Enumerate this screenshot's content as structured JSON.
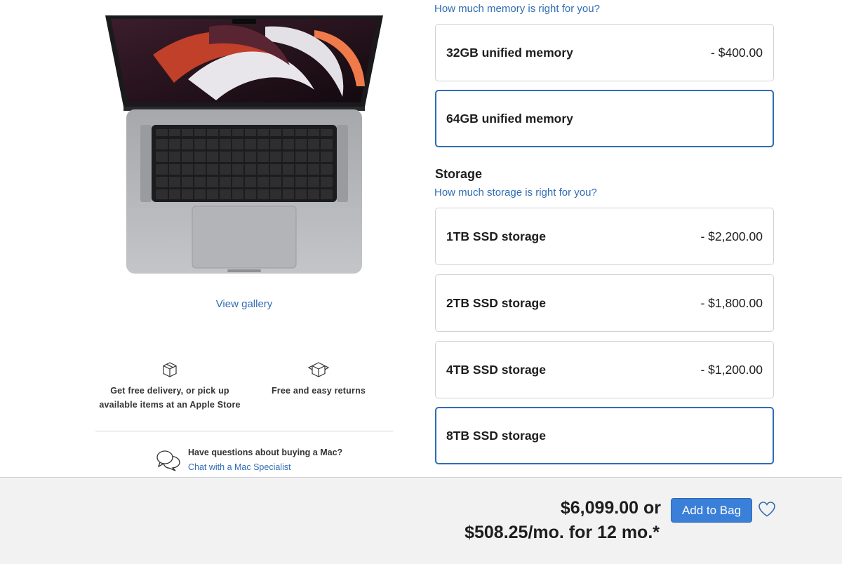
{
  "gallery": {
    "view_label": "View gallery"
  },
  "perks": {
    "delivery_line1": "Get free delivery, or pick up",
    "delivery_line2": "available items at an Apple Store",
    "delivery_icon": "box-icon",
    "returns_label": "Free and easy returns",
    "returns_icon": "return-box-icon"
  },
  "chat": {
    "question": "Have questions about buying a Mac?",
    "link": "Chat with a Mac Specialist",
    "icon": "chat-bubbles-icon"
  },
  "memory": {
    "help_link": "How much memory is right for you?",
    "options": [
      {
        "label": "32GB unified memory",
        "price": "- $400.00",
        "selected": false
      },
      {
        "label": "64GB unified memory",
        "price": "",
        "selected": true
      }
    ]
  },
  "storage": {
    "heading": "Storage",
    "help_link": "How much storage is right for you?",
    "options": [
      {
        "label": "1TB SSD storage",
        "price": "- $2,200.00",
        "selected": false
      },
      {
        "label": "2TB SSD storage",
        "price": "- $1,800.00",
        "selected": false
      },
      {
        "label": "4TB SSD storage",
        "price": "- $1,200.00",
        "selected": false
      },
      {
        "label": "8TB SSD storage",
        "price": "",
        "selected": true
      }
    ]
  },
  "summary": {
    "price_line1": "$6,099.00 or",
    "price_line2": "$508.25/mo. for 12 mo.*",
    "add_to_bag": "Add to Bag",
    "favorite_icon": "heart-icon"
  },
  "colors": {
    "accent": "#2f6cb5",
    "button": "#3a7fd8",
    "bottom_bar": "#f2f2f2",
    "border": "#d2d2d7"
  }
}
